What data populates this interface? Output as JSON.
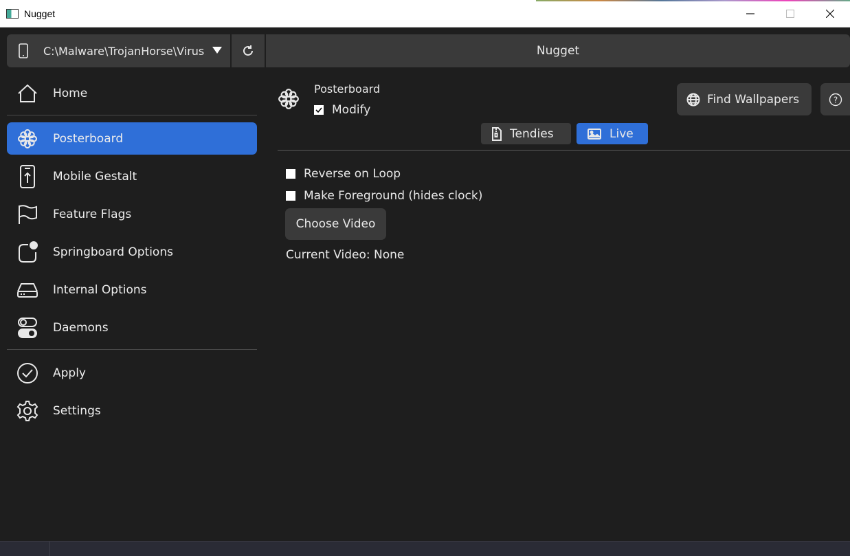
{
  "window": {
    "title": "Nugget"
  },
  "toolbar": {
    "device_path": "C:\\Malware\\TrojanHorse\\Virus.exe",
    "app_title": "Nugget"
  },
  "sidebar": {
    "items": [
      {
        "label": "Home",
        "icon": "home-icon"
      },
      {
        "label": "Posterboard",
        "icon": "flower-icon",
        "active": true
      },
      {
        "label": "Mobile Gestalt",
        "icon": "phone-upload-icon"
      },
      {
        "label": "Feature Flags",
        "icon": "flag-icon"
      },
      {
        "label": "Springboard Options",
        "icon": "app-badge-icon"
      },
      {
        "label": "Internal Options",
        "icon": "drive-icon"
      },
      {
        "label": "Daemons",
        "icon": "toggles-icon"
      },
      {
        "label": "Apply",
        "icon": "check-circle-icon"
      },
      {
        "label": "Settings",
        "icon": "gear-icon"
      }
    ]
  },
  "main": {
    "title": "Posterboard",
    "modify_label": "Modify",
    "modify_checked": true,
    "find_wallpapers_label": "Find Wallpapers",
    "tabs": [
      {
        "label": "Tendies",
        "icon": "zip-file-icon",
        "active": false
      },
      {
        "label": "Live",
        "icon": "image-icon",
        "active": true
      }
    ],
    "options": [
      {
        "label": "Reverse on Loop",
        "checked": false
      },
      {
        "label": "Make Foreground (hides clock)",
        "checked": false
      }
    ],
    "choose_video_label": "Choose Video",
    "current_video_text": "Current Video: None"
  },
  "colors": {
    "accent": "#2f6fd8",
    "background": "#1e1e1e",
    "button": "#3a3a3a"
  }
}
